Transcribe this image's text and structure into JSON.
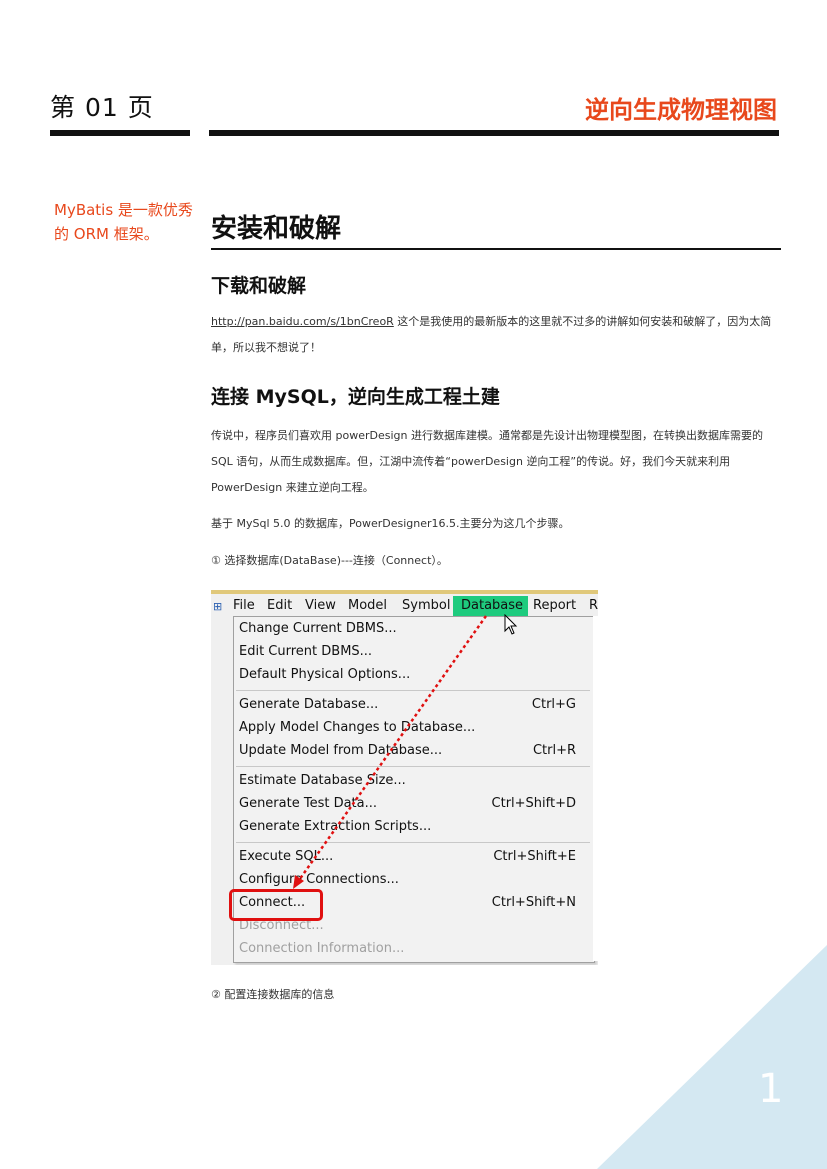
{
  "header": {
    "page_label": "第 01 页",
    "section_title": "逆向生成物理视图"
  },
  "sidenote": "MyBatis 是一款优秀的 ORM 框架。",
  "main": {
    "h1": "安装和破解",
    "h2_download": "下载和破解",
    "download_link": "http://pan.baidu.com/s/1bnCreoR",
    "download_text": " 这个是我使用的最新版本的这里就不过多的讲解如何安装和破解了，因为太简单，所以我不想说了！",
    "h2_connect": "连接 MySQL，逆向生成工程土建",
    "para_intro": "传说中，程序员们喜欢用 powerDesign 进行数据库建模。通常都是先设计出物理模型图，在转换出数据库需要的 SQL 语句，从而生成数据库。但，江湖中流传着“powerDesign 逆向工程”的传说。好，我们今天就来利用 PowerDesign 来建立逆向工程。",
    "para_base": "基于 MySql 5.0 的数据库，PowerDesigner16.5.主要分为这几个步骤。",
    "step1": "① 选择数据库(DataBase)---连接（Connect）。",
    "step2": "② 配置连接数据库的信息"
  },
  "screenshot": {
    "menubar": [
      "File",
      "Edit",
      "View",
      "Model",
      "Symbol",
      "Database",
      "Report",
      "R"
    ],
    "menu_items": [
      {
        "label": "Change Current DBMS...",
        "shortcut": ""
      },
      {
        "label": "Edit Current DBMS...",
        "shortcut": ""
      },
      {
        "label": "Default Physical Options...",
        "shortcut": ""
      },
      {
        "label": "Generate Database...",
        "shortcut": "Ctrl+G"
      },
      {
        "label": "Apply Model Changes to Database...",
        "shortcut": ""
      },
      {
        "label": "Update Model from Database...",
        "shortcut": "Ctrl+R"
      },
      {
        "label": "Estimate Database Size...",
        "shortcut": ""
      },
      {
        "label": "Generate Test Data...",
        "shortcut": "Ctrl+Shift+D"
      },
      {
        "label": "Generate Extraction Scripts...",
        "shortcut": ""
      },
      {
        "label": "Execute SQL...",
        "shortcut": "Ctrl+Shift+E"
      },
      {
        "label": "Configure Connections...",
        "shortcut": ""
      },
      {
        "label": "Connect...",
        "shortcut": "Ctrl+Shift+N"
      },
      {
        "label": "Disconnect...",
        "shortcut": ""
      },
      {
        "label": "Connection Information...",
        "shortcut": ""
      }
    ],
    "highlight_color": "#e01010",
    "active_menu_color": "#1ecb7e"
  },
  "page_number": "1",
  "colors": {
    "accent": "#e8481c",
    "corner": "#d4e8f2"
  }
}
